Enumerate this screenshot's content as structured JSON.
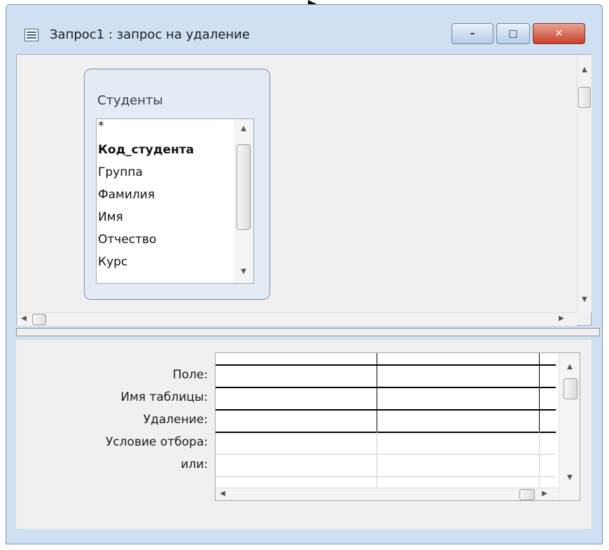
{
  "window": {
    "title": "Запрос1 : запрос на удаление",
    "minimize_label": "–",
    "maximize_label": "□",
    "close_label": "✕"
  },
  "table": {
    "name": "Студенты",
    "fields": [
      "*",
      "Код_студента",
      "Группа",
      "Фамилия",
      "Имя",
      "Отчество",
      "Курс"
    ],
    "key_field": "Код_студента"
  },
  "grid": {
    "row_labels": [
      "Поле:",
      "Имя таблицы:",
      "Удаление:",
      "Условие отбора:",
      "или:"
    ],
    "columns": [
      {
        "field": "",
        "table": "",
        "delete": "",
        "criteria": "",
        "or": ""
      },
      {
        "field": "",
        "table": "",
        "delete": "",
        "criteria": "",
        "or": ""
      },
      {
        "field": "",
        "table": "",
        "delete": "",
        "criteria": "",
        "or": ""
      }
    ]
  },
  "icons": {
    "window_icon": "query-window-icon",
    "pointer": "arrow-annotation-icon"
  },
  "colors": {
    "frame": "#cfe0f2",
    "close_button": "#c7402b",
    "surface": "#f0f0f0"
  }
}
